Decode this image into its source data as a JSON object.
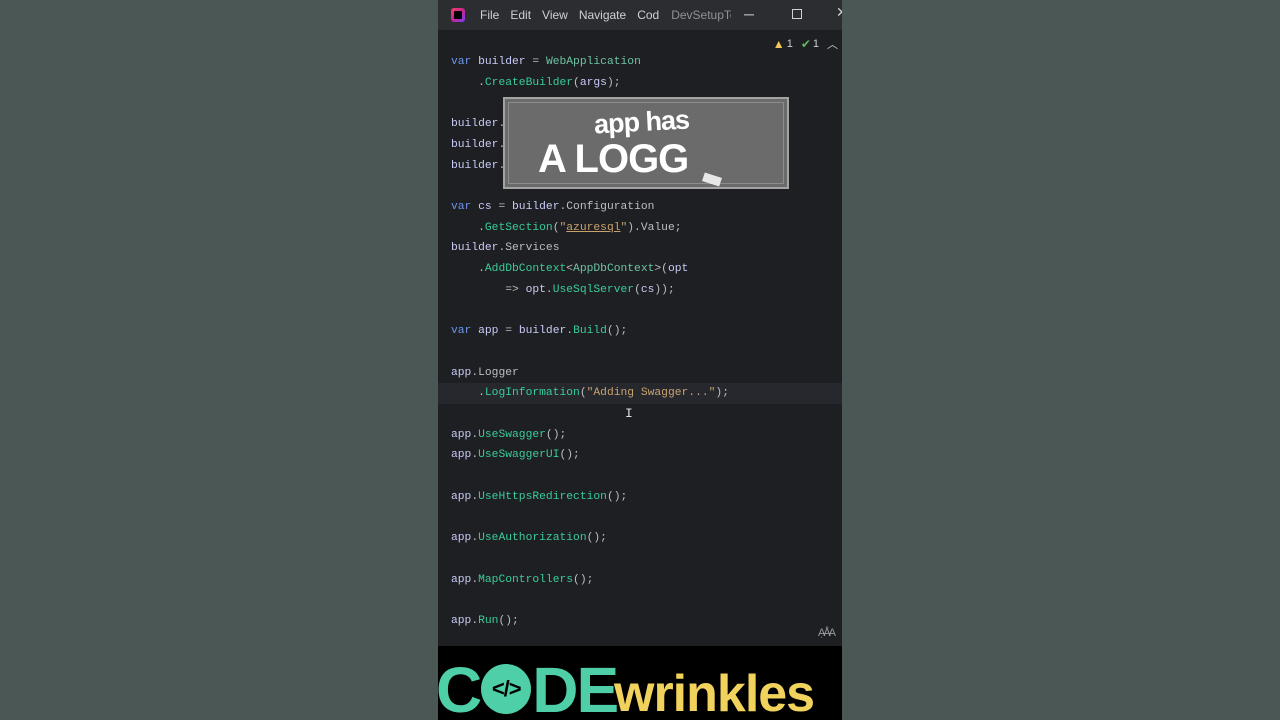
{
  "titlebar": {
    "menu": [
      "File",
      "Edit",
      "View",
      "Navigate",
      "Code"
    ],
    "project": "DevSetupTest"
  },
  "inspections": {
    "warnings": "1",
    "ok": "1"
  },
  "code_lines": [
    [
      [
        "kw",
        "var "
      ],
      [
        "id",
        "builder"
      ],
      [
        "pl",
        " = "
      ],
      [
        "cls",
        "WebApplication"
      ]
    ],
    [
      [
        "pl",
        "    ."
      ],
      [
        "mth",
        "CreateBuilder"
      ],
      [
        "pl",
        "("
      ],
      [
        "id",
        "args"
      ],
      [
        "pl",
        ");"
      ]
    ],
    [],
    [
      [
        "id",
        "builder"
      ],
      [
        "pl",
        "."
      ]
    ],
    [
      [
        "id",
        "builder"
      ],
      [
        "pl",
        "."
      ]
    ],
    [
      [
        "id",
        "builder"
      ],
      [
        "pl",
        "."
      ]
    ],
    [],
    [
      [
        "kw",
        "var "
      ],
      [
        "id",
        "cs"
      ],
      [
        "pl",
        " = "
      ],
      [
        "id",
        "builder"
      ],
      [
        "pl",
        ".Configuration"
      ]
    ],
    [
      [
        "pl",
        "    ."
      ],
      [
        "mth",
        "GetSection"
      ],
      [
        "pl",
        "("
      ],
      [
        "str",
        "\""
      ],
      [
        "strul",
        "azuresql"
      ],
      [
        "str",
        "\""
      ],
      [
        "pl",
        ").Value;"
      ]
    ],
    [
      [
        "id",
        "builder"
      ],
      [
        "pl",
        ".Services"
      ]
    ],
    [
      [
        "pl",
        "    ."
      ],
      [
        "mth",
        "AddDbContext"
      ],
      [
        "pl",
        "<"
      ],
      [
        "cls",
        "AppDbContext"
      ],
      [
        "pl",
        ">("
      ],
      [
        "id",
        "opt"
      ]
    ],
    [
      [
        "pl",
        "        => "
      ],
      [
        "id",
        "opt"
      ],
      [
        "pl",
        "."
      ],
      [
        "mth",
        "UseSqlServer"
      ],
      [
        "pl",
        "("
      ],
      [
        "id",
        "cs"
      ],
      [
        "pl",
        "));"
      ]
    ],
    [],
    [
      [
        "kw",
        "var "
      ],
      [
        "id",
        "app"
      ],
      [
        "pl",
        " = "
      ],
      [
        "id",
        "builder"
      ],
      [
        "pl",
        "."
      ],
      [
        "mth",
        "Build"
      ],
      [
        "pl",
        "();"
      ]
    ],
    [],
    [
      [
        "id",
        "app"
      ],
      [
        "pl",
        ".Logger"
      ]
    ],
    [
      [
        "pl",
        "    ."
      ],
      [
        "mth",
        "LogInformation"
      ],
      [
        "pl",
        "("
      ],
      [
        "str",
        "\"Adding Swagger...\""
      ],
      [
        "pl",
        ");"
      ]
    ],
    [],
    [
      [
        "id",
        "app"
      ],
      [
        "pl",
        "."
      ],
      [
        "mth",
        "UseSwagger"
      ],
      [
        "pl",
        "();"
      ]
    ],
    [
      [
        "id",
        "app"
      ],
      [
        "pl",
        "."
      ],
      [
        "mth",
        "UseSwaggerUI"
      ],
      [
        "pl",
        "();"
      ]
    ],
    [],
    [
      [
        "id",
        "app"
      ],
      [
        "pl",
        "."
      ],
      [
        "mth",
        "UseHttpsRedirection"
      ],
      [
        "pl",
        "();"
      ]
    ],
    [],
    [
      [
        "id",
        "app"
      ],
      [
        "pl",
        "."
      ],
      [
        "mth",
        "UseAuthorization"
      ],
      [
        "pl",
        "();"
      ]
    ],
    [],
    [
      [
        "id",
        "app"
      ],
      [
        "pl",
        "."
      ],
      [
        "mth",
        "MapControllers"
      ],
      [
        "pl",
        "();"
      ]
    ],
    [],
    [
      [
        "id",
        "app"
      ],
      [
        "pl",
        "."
      ],
      [
        "mth",
        "Run"
      ],
      [
        "pl",
        "();"
      ]
    ]
  ],
  "caption": {
    "line1": "app has",
    "line2": "A LOGG"
  },
  "brand": {
    "code": "C",
    "code_rest": "DE",
    "badge": "</>",
    "wrinkles": "wrinkles"
  }
}
